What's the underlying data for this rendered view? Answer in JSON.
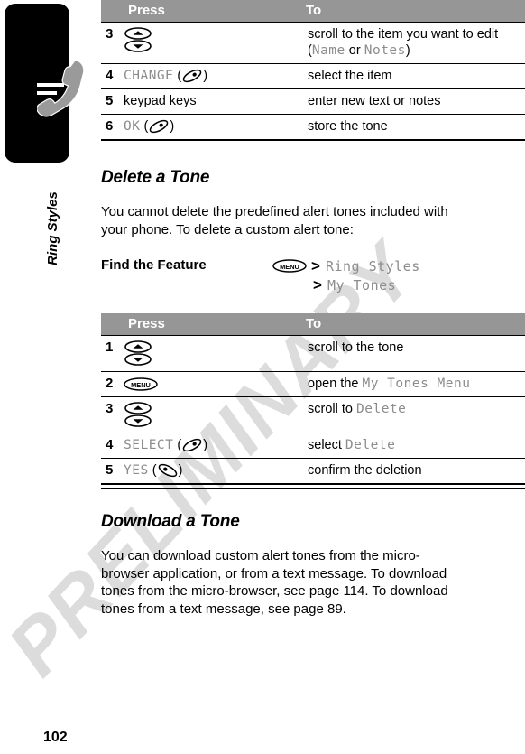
{
  "watermark": {
    "text": "PRELIMINARY"
  },
  "chapter": {
    "label": "Ring Styles",
    "icon": "phone-handset-icon"
  },
  "page_number": "102",
  "table_top": {
    "headers": {
      "press": "Press",
      "to": "To"
    },
    "rows": [
      {
        "num": "3",
        "press_icon": "scroll-key-icon",
        "press": "",
        "to_pre": "scroll to the item you want to edit (",
        "to_screen1": "Name",
        "to_mid": " or ",
        "to_screen2": "Notes",
        "to_post": ")"
      },
      {
        "num": "4",
        "press_screen": "CHANGE",
        "press_icon": "softkey-right-icon",
        "to_pre": "select the item"
      },
      {
        "num": "5",
        "press": "keypad keys",
        "to_pre": "enter new text or notes"
      },
      {
        "num": "6",
        "press_screen": "OK",
        "press_icon": "softkey-right-icon",
        "to_pre": "store the tone"
      }
    ]
  },
  "section_delete": {
    "heading": "Delete a Tone",
    "body": "You cannot delete the predefined alert tones included with your phone. To delete a custom alert tone:",
    "find_the_feature": {
      "label": "Find the Feature",
      "menu_icon": "menu-key-icon",
      "separator": ">",
      "path1": "Ring Styles",
      "path2": "My Tones"
    }
  },
  "table_bottom": {
    "headers": {
      "press": "Press",
      "to": "To"
    },
    "rows": [
      {
        "num": "1",
        "press_icon": "scroll-key-icon",
        "to_pre": "scroll to the tone"
      },
      {
        "num": "2",
        "press_icon": "menu-key-icon",
        "to_pre": "open the ",
        "to_screen1": "My Tones Menu"
      },
      {
        "num": "3",
        "press_icon": "scroll-key-icon",
        "to_pre": "scroll to ",
        "to_screen1": "Delete"
      },
      {
        "num": "4",
        "press_screen": "SELECT",
        "press_icon": "softkey-right-icon",
        "to_pre": "select ",
        "to_screen1": "Delete"
      },
      {
        "num": "5",
        "press_screen": "YES",
        "press_icon": "softkey-left-icon",
        "to_pre": "confirm the deletion"
      }
    ]
  },
  "section_download": {
    "heading": "Download a Tone",
    "body": "You can download custom alert tones from the micro-browser application, or from a text message. To download tones from the micro-browser, see page 114. To download tones from a text message, see page 89."
  }
}
